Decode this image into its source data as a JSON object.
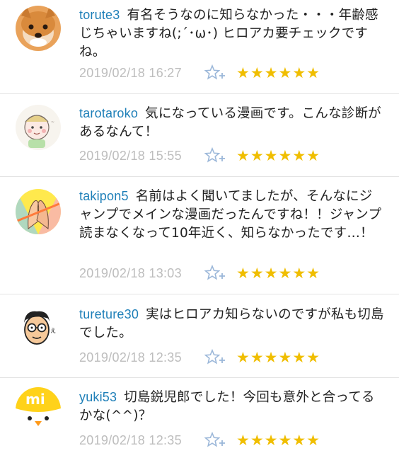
{
  "comments": [
    {
      "user": "torute3",
      "text": "有名そうなのに知らなかった・・・年齢感じちゃいますね(;´･ω･) ヒロアカ要チェックですね。",
      "date": "2019/02/18 16:27",
      "avatar": "shiba-dog-avatar"
    },
    {
      "user": "tarotaroko",
      "text": "気になっている漫画です。こんな診断があるなんて！",
      "date": "2019/02/18 15:55",
      "avatar": "baby-drawing-avatar"
    },
    {
      "user": "takipon5",
      "text": "名前はよく聞いてましたが、そんなにジャンプでメインな漫画だったんですね！！ジャンプ読まなくなって10年近く、知らなかったです…！",
      "date": "2019/02/18 13:03",
      "avatar": "hands-illustration-avatar"
    },
    {
      "user": "tureture30",
      "text": "実はヒロアカ知らないのですが私も切島でした。",
      "date": "2019/02/18 12:35",
      "avatar": "glasses-man-avatar"
    },
    {
      "user": "yuki53",
      "text": "切島鋭児郎でした！今回も意外と合ってるかな(^^)？",
      "date": "2019/02/18 12:35",
      "avatar": "yellow-chick-avatar"
    }
  ],
  "stars_per_comment": 6,
  "star_glyph": "★",
  "colors": {
    "username": "#1e7fb8",
    "star": "#f0be00",
    "date": "#bdbdbd",
    "add_star_icon": "#9bb7d9"
  }
}
